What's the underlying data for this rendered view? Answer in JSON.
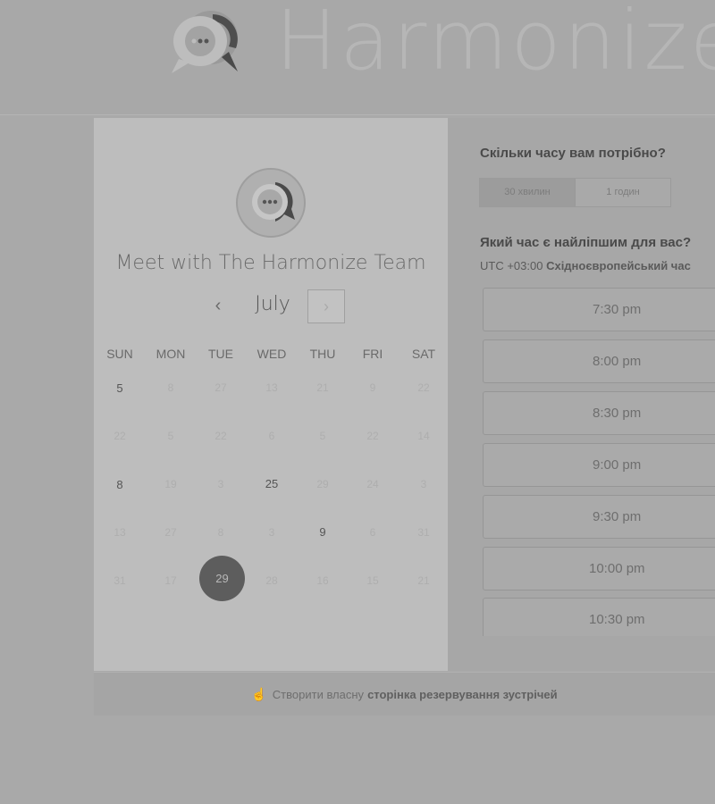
{
  "header": {
    "brand_name": "Harmonize"
  },
  "booking": {
    "title": "Meet with The Harmonize Team",
    "prev_label": "‹",
    "next_label": "›",
    "month": "July",
    "weekdays": [
      "SUN",
      "MON",
      "TUE",
      "WED",
      "THU",
      "FRI",
      "SAT"
    ],
    "weeks": [
      [
        "5",
        "8",
        "27",
        "13",
        "21",
        "9",
        "22"
      ],
      [
        "22",
        "5",
        "22",
        "6",
        "5",
        "22",
        "14"
      ],
      [
        "8",
        "19",
        "3",
        "25",
        "29",
        "24",
        "3"
      ],
      [
        "13",
        "27",
        "8",
        "3",
        "9",
        "6",
        "31"
      ],
      [
        "31",
        "17",
        "29",
        "28",
        "16",
        "15",
        "21"
      ]
    ],
    "available_days": [
      "5",
      "8",
      "25",
      "9"
    ],
    "selected_day": "29"
  },
  "scheduler": {
    "duration_question": "Скільки часу вам потрібно?",
    "durations": [
      {
        "label": "30 хвилин",
        "active": true
      },
      {
        "label": "1 годин",
        "active": false
      }
    ],
    "time_question": "Який час є найліпшим для вас?",
    "timezone_offset": "UTC +03:00",
    "timezone_name": "Східноєвропейський час",
    "slots": [
      "7:30 pm",
      "8:00 pm",
      "8:30 pm",
      "9:00 pm",
      "9:30 pm",
      "10:00 pm",
      "10:30 pm"
    ]
  },
  "footer": {
    "icon": "pointing-hand-icon",
    "prefix": "Створити власну",
    "link": "сторінка резервування зустрічей"
  },
  "colors": {
    "selected_day": "#5d5d5d",
    "panel_left": "#bdbdbd",
    "background": "#a9a9a9"
  }
}
